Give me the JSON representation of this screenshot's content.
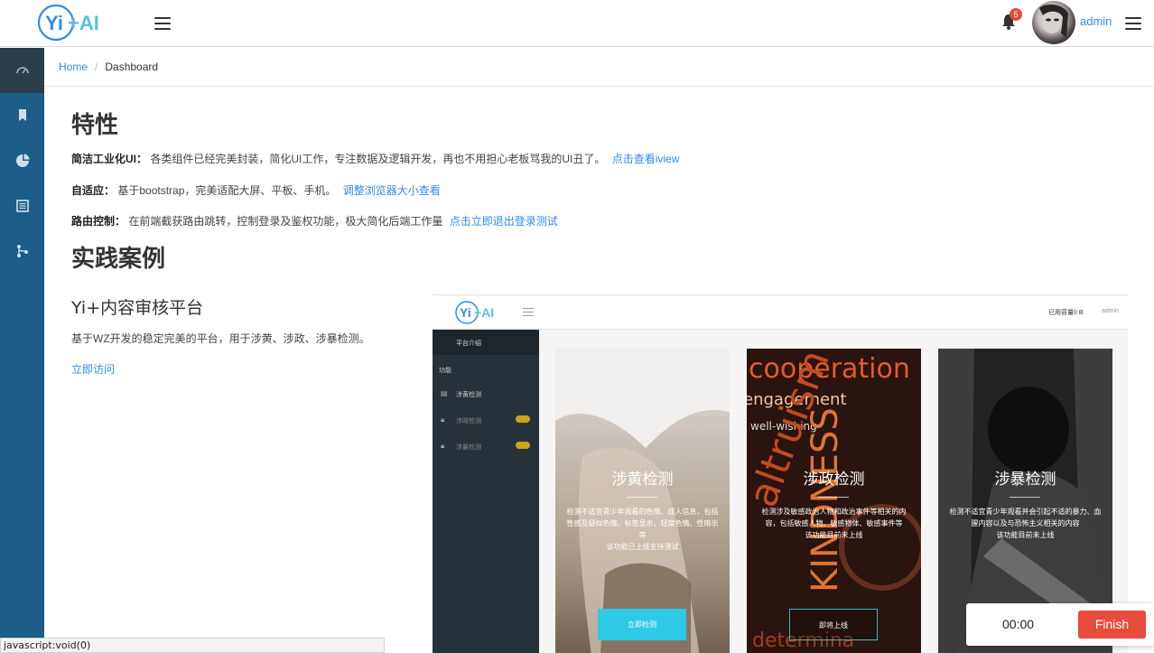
{
  "header": {
    "logo_text": "Yi+AI",
    "notifications_count": "5",
    "username": "admin"
  },
  "sidebar": {
    "items": [
      {
        "icon": "dashboard-icon",
        "active": true
      },
      {
        "icon": "bookmark-icon",
        "active": false
      },
      {
        "icon": "pie-chart-icon",
        "active": false
      },
      {
        "icon": "list-icon",
        "active": false
      },
      {
        "icon": "branch-icon",
        "active": false
      }
    ]
  },
  "breadcrumb": {
    "home": "Home",
    "current": "Dashboard"
  },
  "features": {
    "title": "特性",
    "items": [
      {
        "label": "简洁工业化UI：",
        "text": "各类组件已经完美封装，简化UI工作，专注数据及逻辑开发，再也不用担心老板骂我的UI丑了。",
        "link": "点击查看iview"
      },
      {
        "label": "自适应：",
        "text": "基于bootstrap，完美适配大屏、平板、手机。",
        "link": "调整浏览器大小查看"
      },
      {
        "label": "路由控制：",
        "text": "在前端截获路由跳转，控制登录及鉴权功能，极大简化后端工作量",
        "link": "点击立即退出登录测试"
      }
    ]
  },
  "cases": {
    "title": "实践案例",
    "item_title": "Yi+内容审核平台",
    "item_desc": "基于WZ开发的稳定完美的平台，用于涉黄、涉政、涉暴检测。",
    "item_link": "立即访问"
  },
  "preview": {
    "logo_text": "Yi+AI",
    "usage": "已用容量0 B",
    "user": "admin",
    "side_head": "平台介绍",
    "side_section": "功能",
    "side_items": [
      "涉黄检测",
      "涉政检测",
      "涉暴检测"
    ],
    "cards": [
      {
        "title": "涉黄检测",
        "text": "检测不适宜青少年观看的色情、成人信息，包括性感及疑似色情、标签显示，轻度色情、性暗示等",
        "status": "该功能已上线支持测试",
        "button": "立即检测",
        "color": "#2ec9e6"
      },
      {
        "title": "涉政检测",
        "text": "检测涉及敏感政治人物和政治事件等相关的内容，包括敏感人物、敏感物体、敏感事件等",
        "status": "该功能目前未上线",
        "button": "即将上线",
        "color": "#3bb7c9"
      },
      {
        "title": "涉暴检测",
        "text": "检测不适宜青少年观看并会引起不适的暴力、血腥内容以及与恐怖主义相关的内容",
        "status": "该功能目前未上线",
        "button": "",
        "color": "#555555"
      }
    ]
  },
  "statusbar": {
    "text": "javascript:void(0)"
  },
  "timer": {
    "time": "00:00",
    "finish_label": "Finish"
  }
}
